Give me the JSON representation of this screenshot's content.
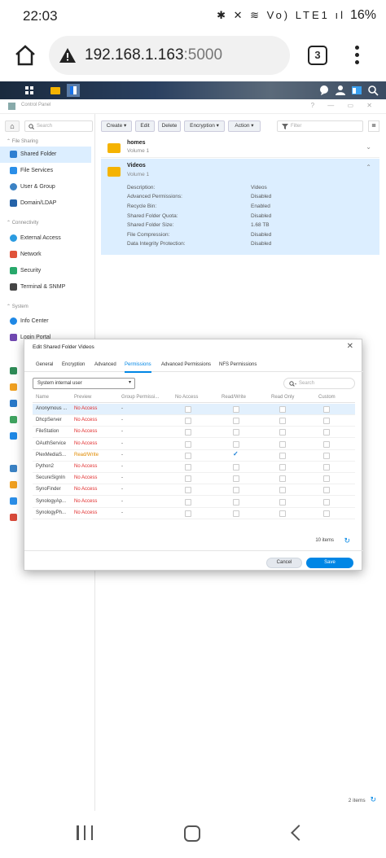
{
  "status": {
    "time": "22:03",
    "battery": "16%",
    "icons": "✱ ✕ ≋ Vo) LTE1 ıl"
  },
  "browser": {
    "host": "192.168.1.163",
    "port": ":5000",
    "tab_count": "3"
  },
  "app": {
    "title": "Control Panel",
    "window_controls": "? — ▭ ✕"
  },
  "sidebar": {
    "search_placeholder": "Search",
    "sections": [
      {
        "label": "File Sharing",
        "items": [
          "Shared Folder",
          "File Services",
          "User & Group",
          "Domain/LDAP"
        ]
      },
      {
        "label": "Connectivity",
        "items": [
          "External Access",
          "Network",
          "Security",
          "Terminal & SNMP"
        ]
      },
      {
        "label": "System",
        "items": [
          "Info Center",
          "Login Portal"
        ]
      }
    ],
    "active": "Shared Folder"
  },
  "toolbar": {
    "create": "Create ▾",
    "edit": "Edit",
    "delete": "Delete",
    "encryption": "Encryption ▾",
    "action": "Action ▾",
    "filter_placeholder": "Filter"
  },
  "shares": [
    {
      "name": "homes",
      "volume": "Volume 1"
    },
    {
      "name": "Videos",
      "volume": "Volume 1"
    }
  ],
  "details": [
    {
      "label": "Description:",
      "value": "Videos"
    },
    {
      "label": "Advanced Permissions:",
      "value": "Disabled"
    },
    {
      "label": "Recycle Bin:",
      "value": "Enabled"
    },
    {
      "label": "Shared Folder Quota:",
      "value": "Disabled"
    },
    {
      "label": "Shared Folder Size:",
      "value": "1.68 TB"
    },
    {
      "label": "File Compression:",
      "value": "Disabled"
    },
    {
      "label": "Data Integrity Protection:",
      "value": "Disabled"
    }
  ],
  "footer_count": "2 items",
  "dialog": {
    "title": "Edit Shared Folder Videos",
    "tabs": [
      "General",
      "Encryption",
      "Advanced",
      "Permissions",
      "Advanced Permissions",
      "NFS Permissions"
    ],
    "active_tab": "Permissions",
    "user_select": "System internal user",
    "search_placeholder": "Search",
    "columns": [
      "Name",
      "Preview",
      "Group Permissi...",
      "No Access",
      "Read/Write",
      "Read Only",
      "Custom"
    ],
    "rows": [
      {
        "name": "Anonymous ...",
        "preview": "No Access",
        "group": "-",
        "rw": false
      },
      {
        "name": "DhcpServer",
        "preview": "No Access",
        "group": "-",
        "rw": false
      },
      {
        "name": "FileStation",
        "preview": "No Access",
        "group": "-",
        "rw": false
      },
      {
        "name": "OAuthService",
        "preview": "No Access",
        "group": "-",
        "rw": false
      },
      {
        "name": "PlexMediaS...",
        "preview": "Read/Write",
        "group": "-",
        "rw": true
      },
      {
        "name": "Python2",
        "preview": "No Access",
        "group": "-",
        "rw": false
      },
      {
        "name": "SecureSignIn",
        "preview": "No Access",
        "group": "-",
        "rw": false
      },
      {
        "name": "SynoFinder",
        "preview": "No Access",
        "group": "-",
        "rw": false
      },
      {
        "name": "SynologyAp...",
        "preview": "No Access",
        "group": "-",
        "rw": false
      },
      {
        "name": "SynologyPh...",
        "preview": "No Access",
        "group": "-",
        "rw": false
      }
    ],
    "count": "10 items",
    "cancel": "Cancel",
    "save": "Save"
  },
  "colors": {
    "accent": "#0086e5",
    "no_access": "#e02a2a",
    "read_write": "#e08a00",
    "selected": "#dceeff"
  }
}
